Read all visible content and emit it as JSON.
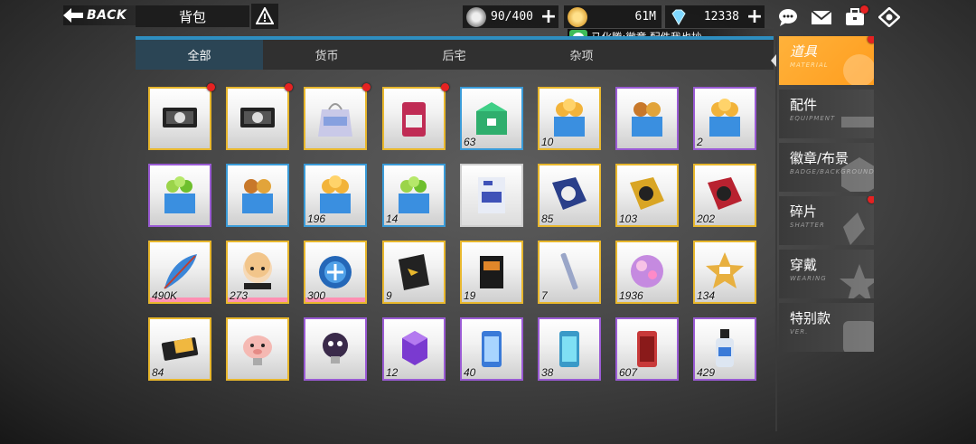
{
  "header": {
    "back_label": "BACK",
    "title": "背包",
    "stamina_value": "90/400",
    "gold_value": "61M",
    "diamond_value": "12338"
  },
  "chat": {
    "sender": "马化腾",
    "message": "徽章 配件我也抄"
  },
  "tabs": [
    {
      "label": "全部",
      "active": true
    },
    {
      "label": "货币"
    },
    {
      "label": "后宅"
    },
    {
      "label": "杂项"
    }
  ],
  "categories": [
    {
      "label": "道具",
      "sub": "MATERIAL",
      "active": true,
      "badge": true
    },
    {
      "label": "配件",
      "sub": "EQUIPMENT"
    },
    {
      "label": "徽章/布景",
      "sub": "BADGE/BACKGROUND"
    },
    {
      "label": "碎片",
      "sub": "SHATTER",
      "badge": true
    },
    {
      "label": "穿戴",
      "sub": "WEARING"
    },
    {
      "label": "特别款",
      "sub": "VER."
    }
  ],
  "items": [
    {
      "qty": "",
      "icon": "ticket-icon",
      "rarity": "gold",
      "badge": true
    },
    {
      "qty": "",
      "icon": "ticket-icon",
      "rarity": "gold",
      "badge": true
    },
    {
      "qty": "",
      "icon": "gift-bag-icon",
      "rarity": "gold",
      "badge": true
    },
    {
      "qty": "",
      "icon": "coffee-bag-icon",
      "rarity": "gold",
      "badge": true
    },
    {
      "qty": "63",
      "icon": "green-box-icon",
      "rarity": "blue"
    },
    {
      "qty": "10",
      "icon": "coin-box-icon",
      "rarity": "gold"
    },
    {
      "qty": "",
      "icon": "gear-box-icon",
      "rarity": "purple"
    },
    {
      "qty": "2",
      "icon": "coin-box-icon",
      "rarity": "purple"
    },
    {
      "qty": "",
      "icon": "exp-box-icon",
      "rarity": "purple"
    },
    {
      "qty": "",
      "icon": "gear-box-icon",
      "rarity": "blue"
    },
    {
      "qty": "196",
      "icon": "coin-box-icon",
      "rarity": "blue"
    },
    {
      "qty": "14",
      "icon": "exp-box-icon",
      "rarity": "blue"
    },
    {
      "qty": "",
      "icon": "card-icon",
      "rarity": "gray"
    },
    {
      "qty": "85",
      "icon": "blue-ticket-icon",
      "rarity": "gold"
    },
    {
      "qty": "103",
      "icon": "gold-ticket-icon",
      "rarity": "gold"
    },
    {
      "qty": "202",
      "icon": "red-ticket-icon",
      "rarity": "gold"
    },
    {
      "qty": "490K",
      "icon": "feather-icon",
      "rarity": "pink"
    },
    {
      "qty": "273",
      "icon": "chibi-badge-icon",
      "rarity": "pink"
    },
    {
      "qty": "300",
      "icon": "blue-orb-icon",
      "rarity": "pink"
    },
    {
      "qty": "9",
      "icon": "badge-book-icon",
      "rarity": "gold"
    },
    {
      "qty": "19",
      "icon": "book-icon",
      "rarity": "gold"
    },
    {
      "qty": "7",
      "icon": "pen-icon",
      "rarity": "gold"
    },
    {
      "qty": "1936",
      "icon": "pink-ball-icon",
      "rarity": "gold"
    },
    {
      "qty": "134",
      "icon": "star-badge-icon",
      "rarity": "gold"
    },
    {
      "qty": "84",
      "icon": "cash-card-icon",
      "rarity": "gold"
    },
    {
      "qty": "",
      "icon": "pig-usb-icon",
      "rarity": "gold"
    },
    {
      "qty": "",
      "icon": "dark-usb-icon",
      "rarity": "purple"
    },
    {
      "qty": "12",
      "icon": "purple-crystal-icon",
      "rarity": "purple"
    },
    {
      "qty": "40",
      "icon": "blue-canister-icon",
      "rarity": "purple"
    },
    {
      "qty": "38",
      "icon": "cyan-canister-icon",
      "rarity": "purple"
    },
    {
      "qty": "607",
      "icon": "red-canister-icon",
      "rarity": "purple"
    },
    {
      "qty": "429",
      "icon": "bottle-icon",
      "rarity": "purple"
    }
  ],
  "colors": {
    "accent_blue": "#2e8ec0",
    "active_orange": "#ffa428",
    "rarity_gold": "#e8b72d",
    "rarity_purple": "#9a5bd4",
    "rarity_blue": "#3a9bd8",
    "badge_red": "#e52222"
  }
}
